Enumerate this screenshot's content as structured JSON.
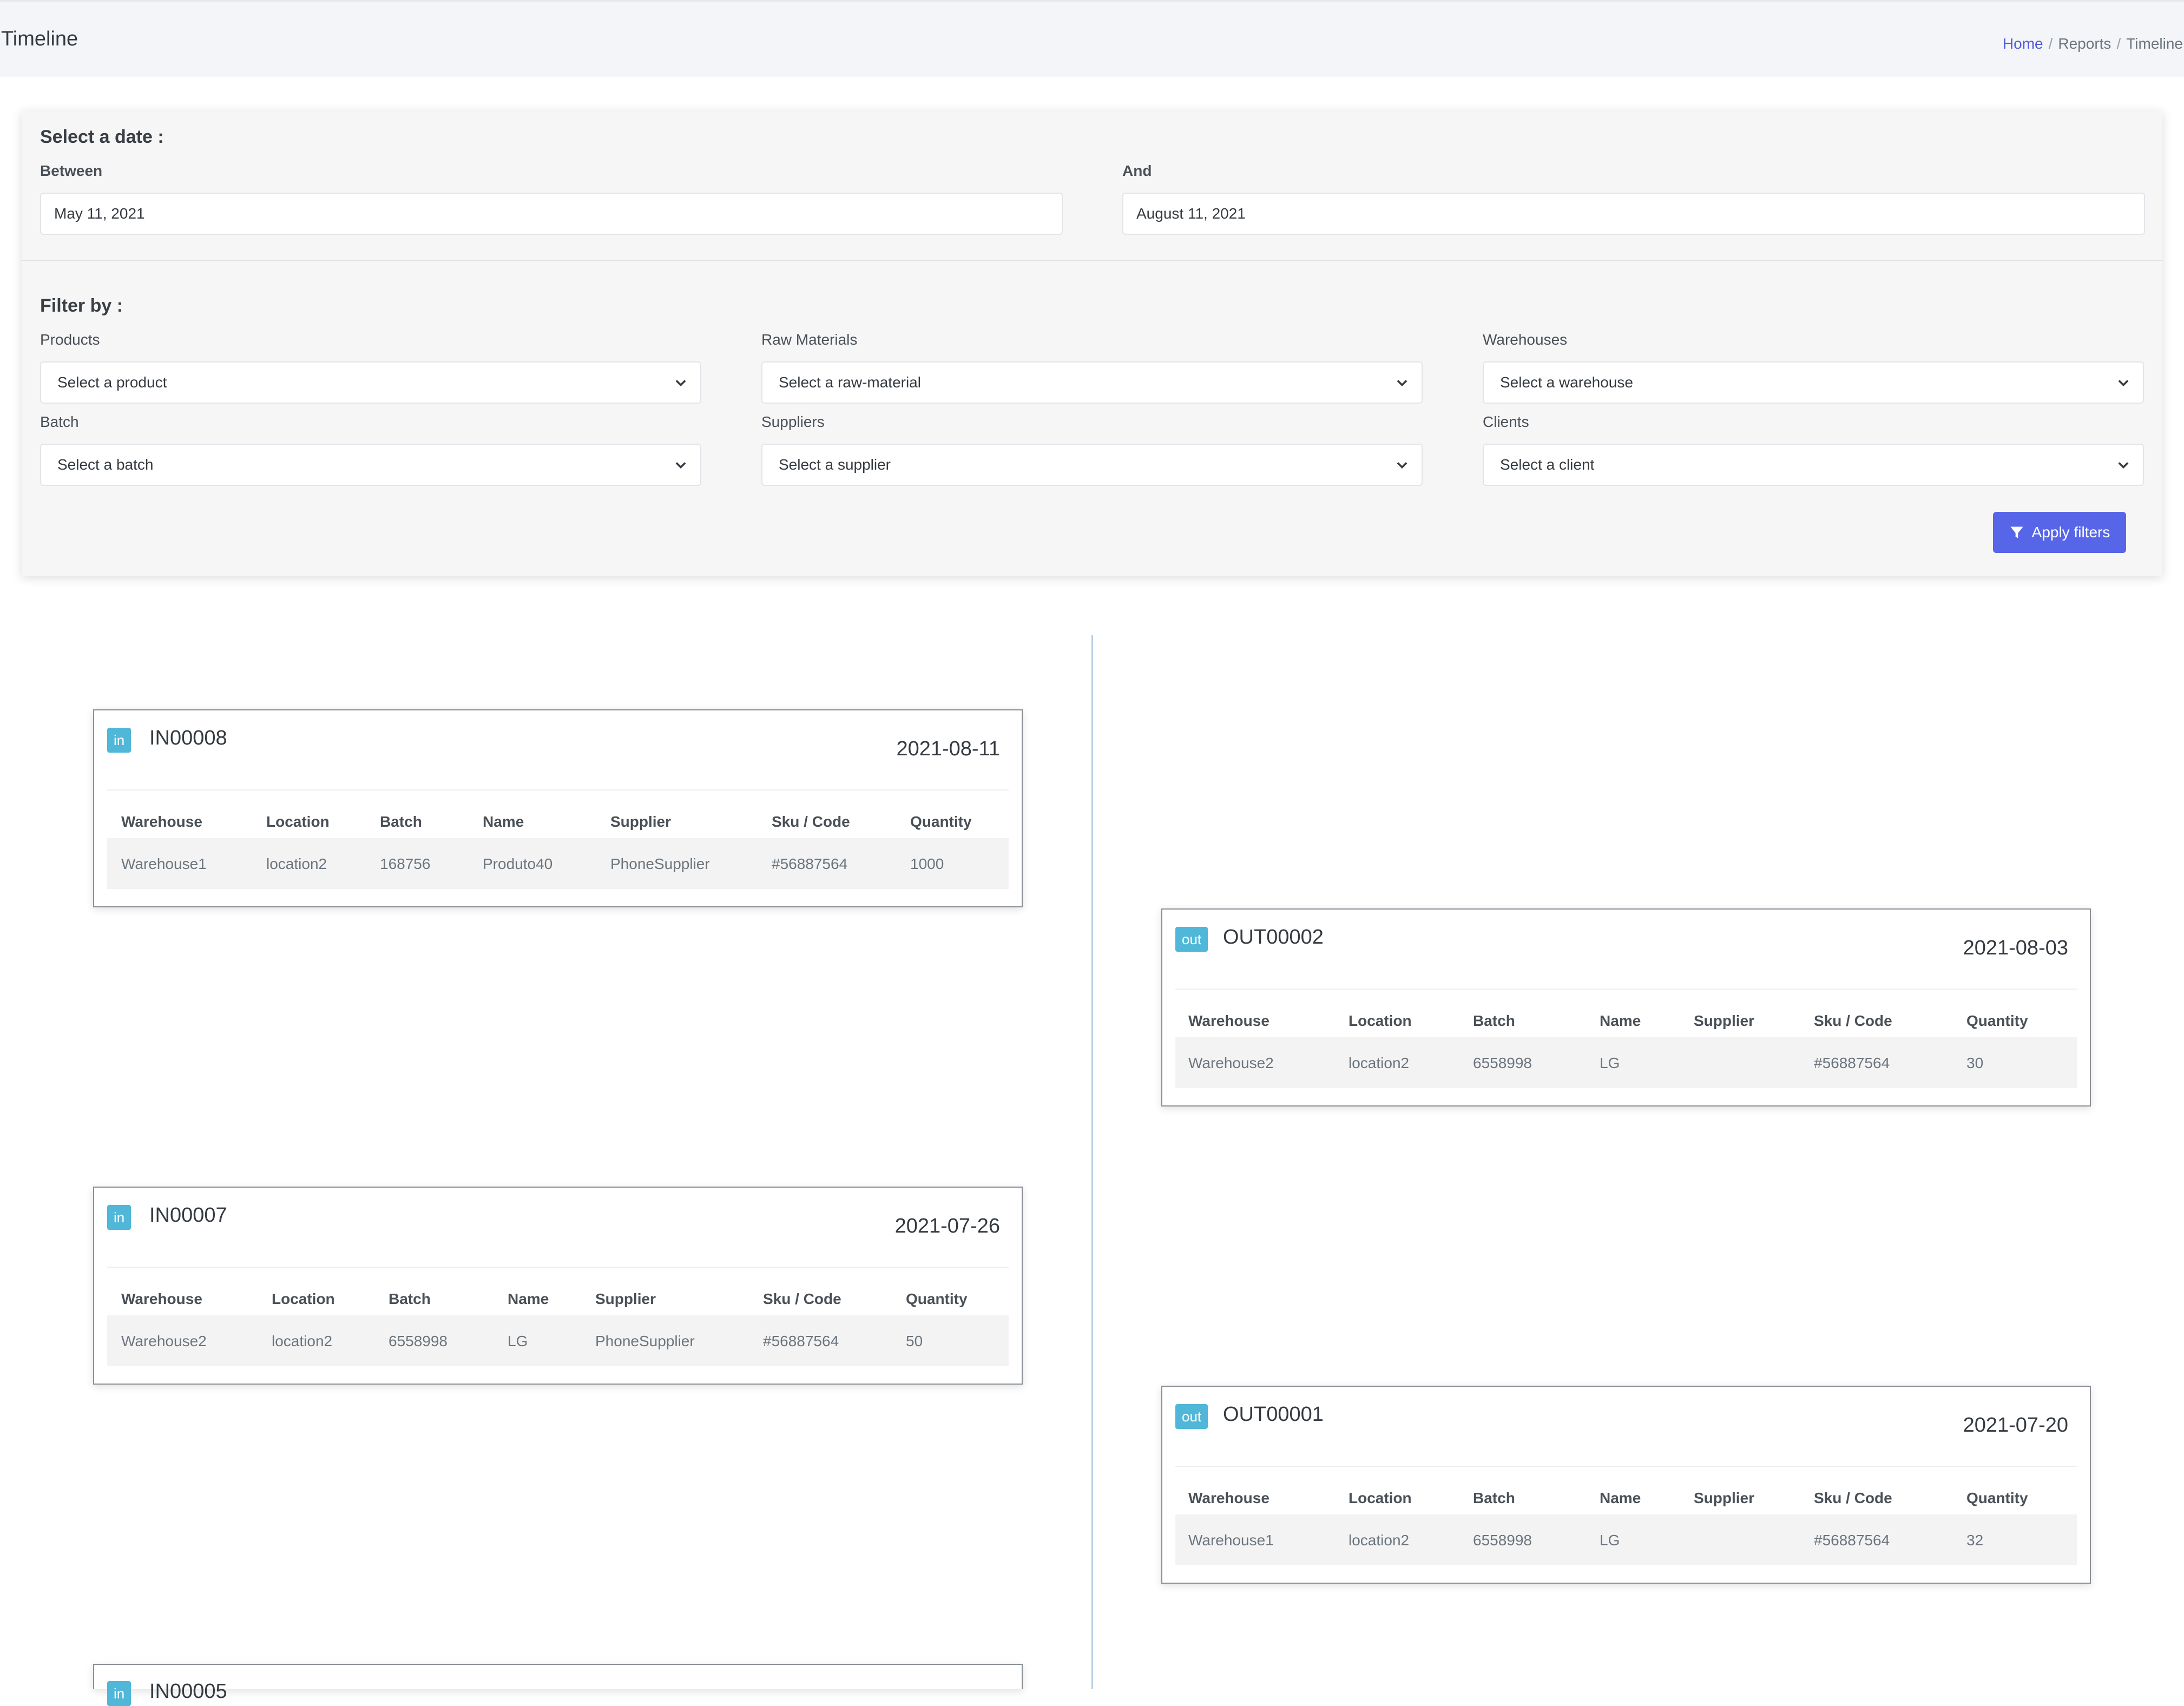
{
  "header": {
    "title": "Timeline",
    "breadcrumb": {
      "home": "Home",
      "reports": "Reports",
      "current": "Timeline",
      "separator": "/"
    }
  },
  "filters": {
    "date_title": "Select a date :",
    "between_label": "Between",
    "between_value": "May 11, 2021",
    "and_label": "And",
    "and_value": "August 11, 2021",
    "filter_title": "Filter by :",
    "products": {
      "label": "Products",
      "value": "Select a product"
    },
    "raw_materials": {
      "label": "Raw Materials",
      "value": "Select a raw-material"
    },
    "warehouses": {
      "label": "Warehouses",
      "value": "Select a warehouse"
    },
    "batch": {
      "label": "Batch",
      "value": "Select a batch"
    },
    "suppliers": {
      "label": "Suppliers",
      "value": "Select a supplier"
    },
    "clients": {
      "label": "Clients",
      "value": "Select a client"
    },
    "apply_label": "Apply filters",
    "apply_icon": "filter-icon",
    "accent_color": "#5765e8"
  },
  "table_headers": [
    "Warehouse",
    "Location",
    "Batch",
    "Name",
    "Supplier",
    "Sku / Code",
    "Quantity"
  ],
  "events": [
    {
      "type": "in",
      "code": "IN00008",
      "date": "2021-08-11",
      "row": [
        "Warehouse1",
        "location2",
        "168756",
        "Produto40",
        "PhoneSupplier",
        "#56887564",
        "1000"
      ]
    },
    {
      "type": "out",
      "code": "OUT00002",
      "date": "2021-08-03",
      "row": [
        "Warehouse2",
        "location2",
        "6558998",
        "LG",
        "",
        "#56887564",
        "30"
      ]
    },
    {
      "type": "in",
      "code": "IN00007",
      "date": "2021-07-26",
      "row": [
        "Warehouse2",
        "location2",
        "6558998",
        "LG",
        "PhoneSupplier",
        "#56887564",
        "50"
      ]
    },
    {
      "type": "out",
      "code": "OUT00001",
      "date": "2021-07-20",
      "row": [
        "Warehouse1",
        "location2",
        "6558998",
        "LG",
        "",
        "#56887564",
        "32"
      ]
    },
    {
      "type": "in",
      "code": "IN00005"
    }
  ],
  "badge_color": "#50b7d8"
}
